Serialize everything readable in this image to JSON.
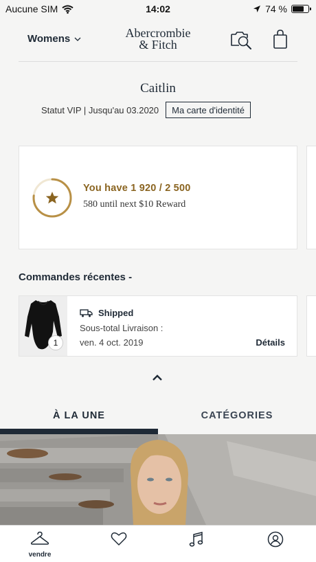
{
  "status_bar": {
    "carrier": "Aucune SIM",
    "time": "14:02",
    "battery": "74 %",
    "battery_level": 0.74
  },
  "header": {
    "gender_label": "Womens",
    "logo_line1": "Abercrombie",
    "logo_line2": "& Fitch",
    "icons": [
      "visual-search-icon",
      "shopping-bag-icon"
    ]
  },
  "profile": {
    "name": "Caitlin",
    "vip_text": "Statut VIP | Jusqu'au 03.2020",
    "id_card_label": "Ma carte d'identité"
  },
  "rewards": {
    "main_text": "You have 1 920 / 2 500",
    "sub_text": "580 until next $10 Reward",
    "progress": 0.768,
    "accent_color": "#8a6420"
  },
  "orders": {
    "section_title": "Commandes récentes -",
    "items": [
      {
        "status": "Shipped",
        "subtotal_label": "Sous-total Livraison :",
        "date": "ven. 4 oct. 2019",
        "details_label": "Détails",
        "quantity": "1"
      }
    ]
  },
  "tabs": [
    {
      "label": "À LA UNE",
      "active": true
    },
    {
      "label": "CATÉGORIES",
      "active": false
    }
  ],
  "bottom_nav": [
    {
      "icon": "hanger-icon",
      "label": "vendre"
    },
    {
      "icon": "heart-icon",
      "label": ""
    },
    {
      "icon": "music-icon",
      "label": ""
    },
    {
      "icon": "account-icon",
      "label": ""
    }
  ]
}
